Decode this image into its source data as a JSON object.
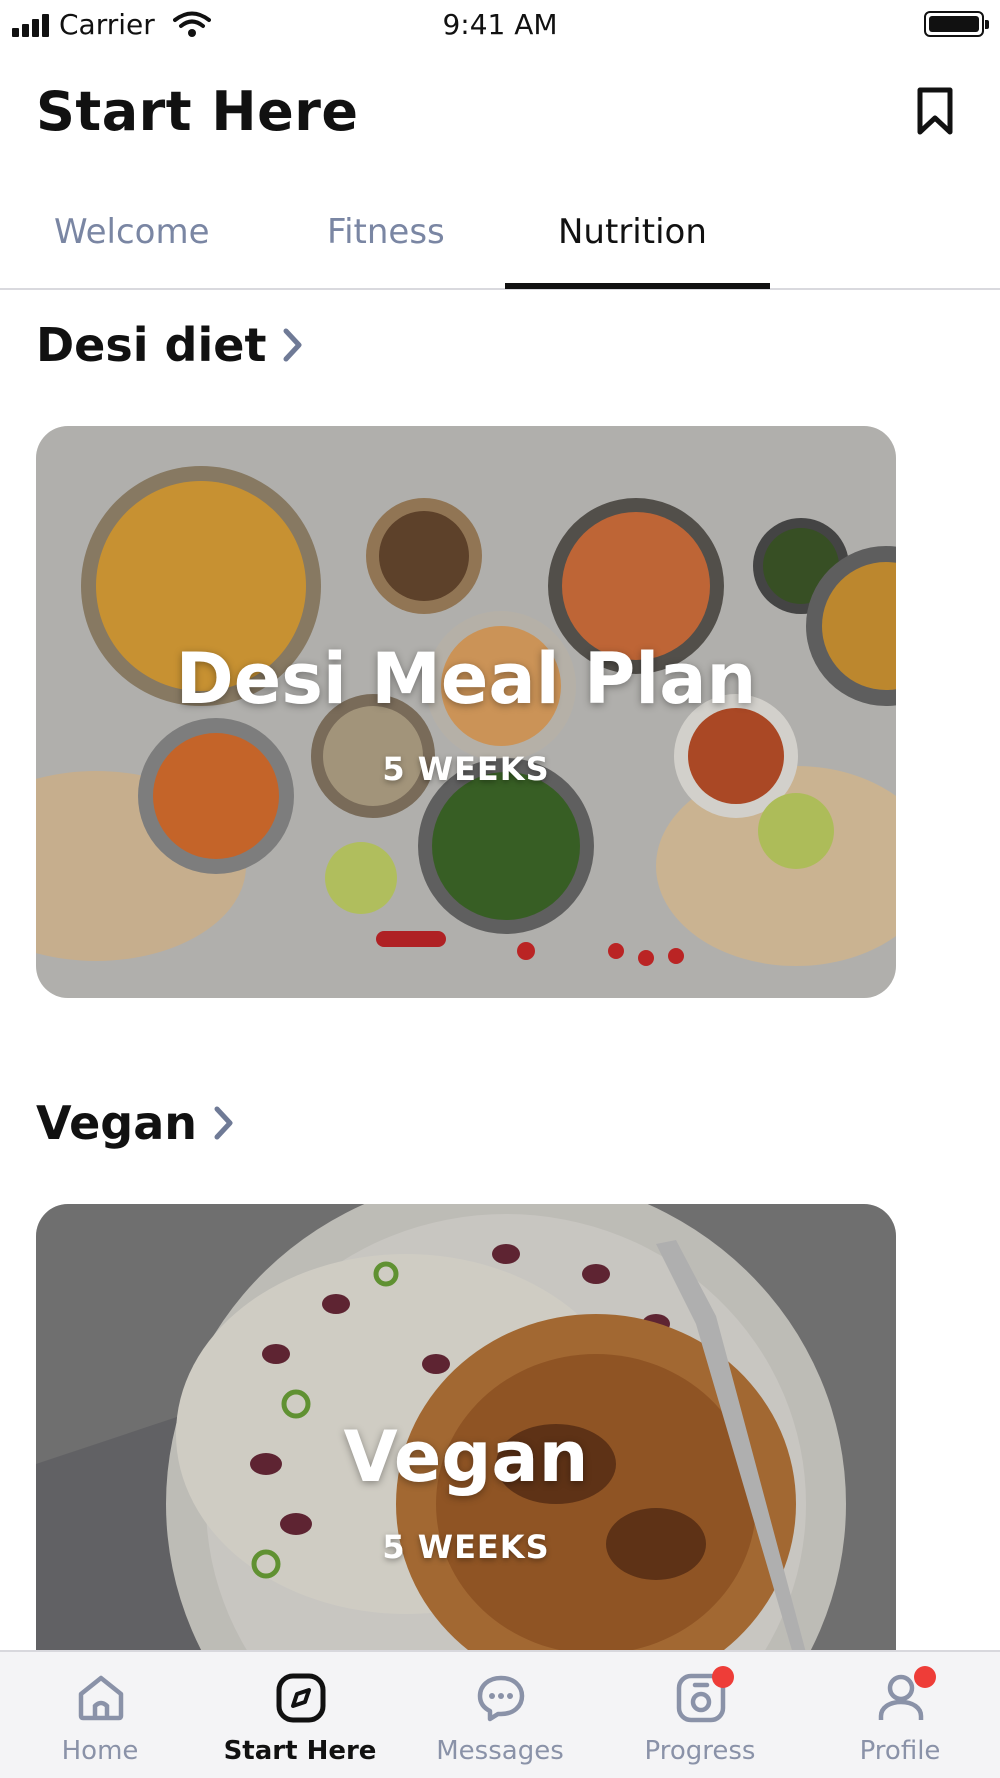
{
  "status_bar": {
    "carrier": "Carrier",
    "time": "9:41 AM",
    "icons": [
      "signal-bars-icon",
      "wifi-icon",
      "battery-icon"
    ]
  },
  "header": {
    "title": "Start Here",
    "bookmark_icon": "bookmark-icon"
  },
  "tabs": [
    {
      "label": "Welcome",
      "active": false
    },
    {
      "label": "Fitness",
      "active": false
    },
    {
      "label": "Nutrition",
      "active": true
    }
  ],
  "sections": [
    {
      "heading": "Desi diet",
      "card": {
        "title": "Desi Meal Plan",
        "duration": "5  WEEKS"
      }
    },
    {
      "heading": "Vegan",
      "card": {
        "title": "Vegan",
        "duration": "5  WEEKS"
      }
    }
  ],
  "bottom_nav": {
    "items": [
      {
        "label": "Home",
        "icon": "home-icon",
        "active": false,
        "badge": false
      },
      {
        "label": "Start Here",
        "icon": "compass-icon",
        "active": true,
        "badge": false
      },
      {
        "label": "Messages",
        "icon": "chat-bubble-icon",
        "active": false,
        "badge": false
      },
      {
        "label": "Progress",
        "icon": "camera-icon",
        "active": false,
        "badge": true
      },
      {
        "label": "Profile",
        "icon": "user-icon",
        "active": false,
        "badge": true
      }
    ]
  },
  "colors": {
    "accent": "#111111",
    "inactive_tab": "#7a86a3",
    "badge": "#ee3d38",
    "nav_background": "#f4f4f6"
  }
}
